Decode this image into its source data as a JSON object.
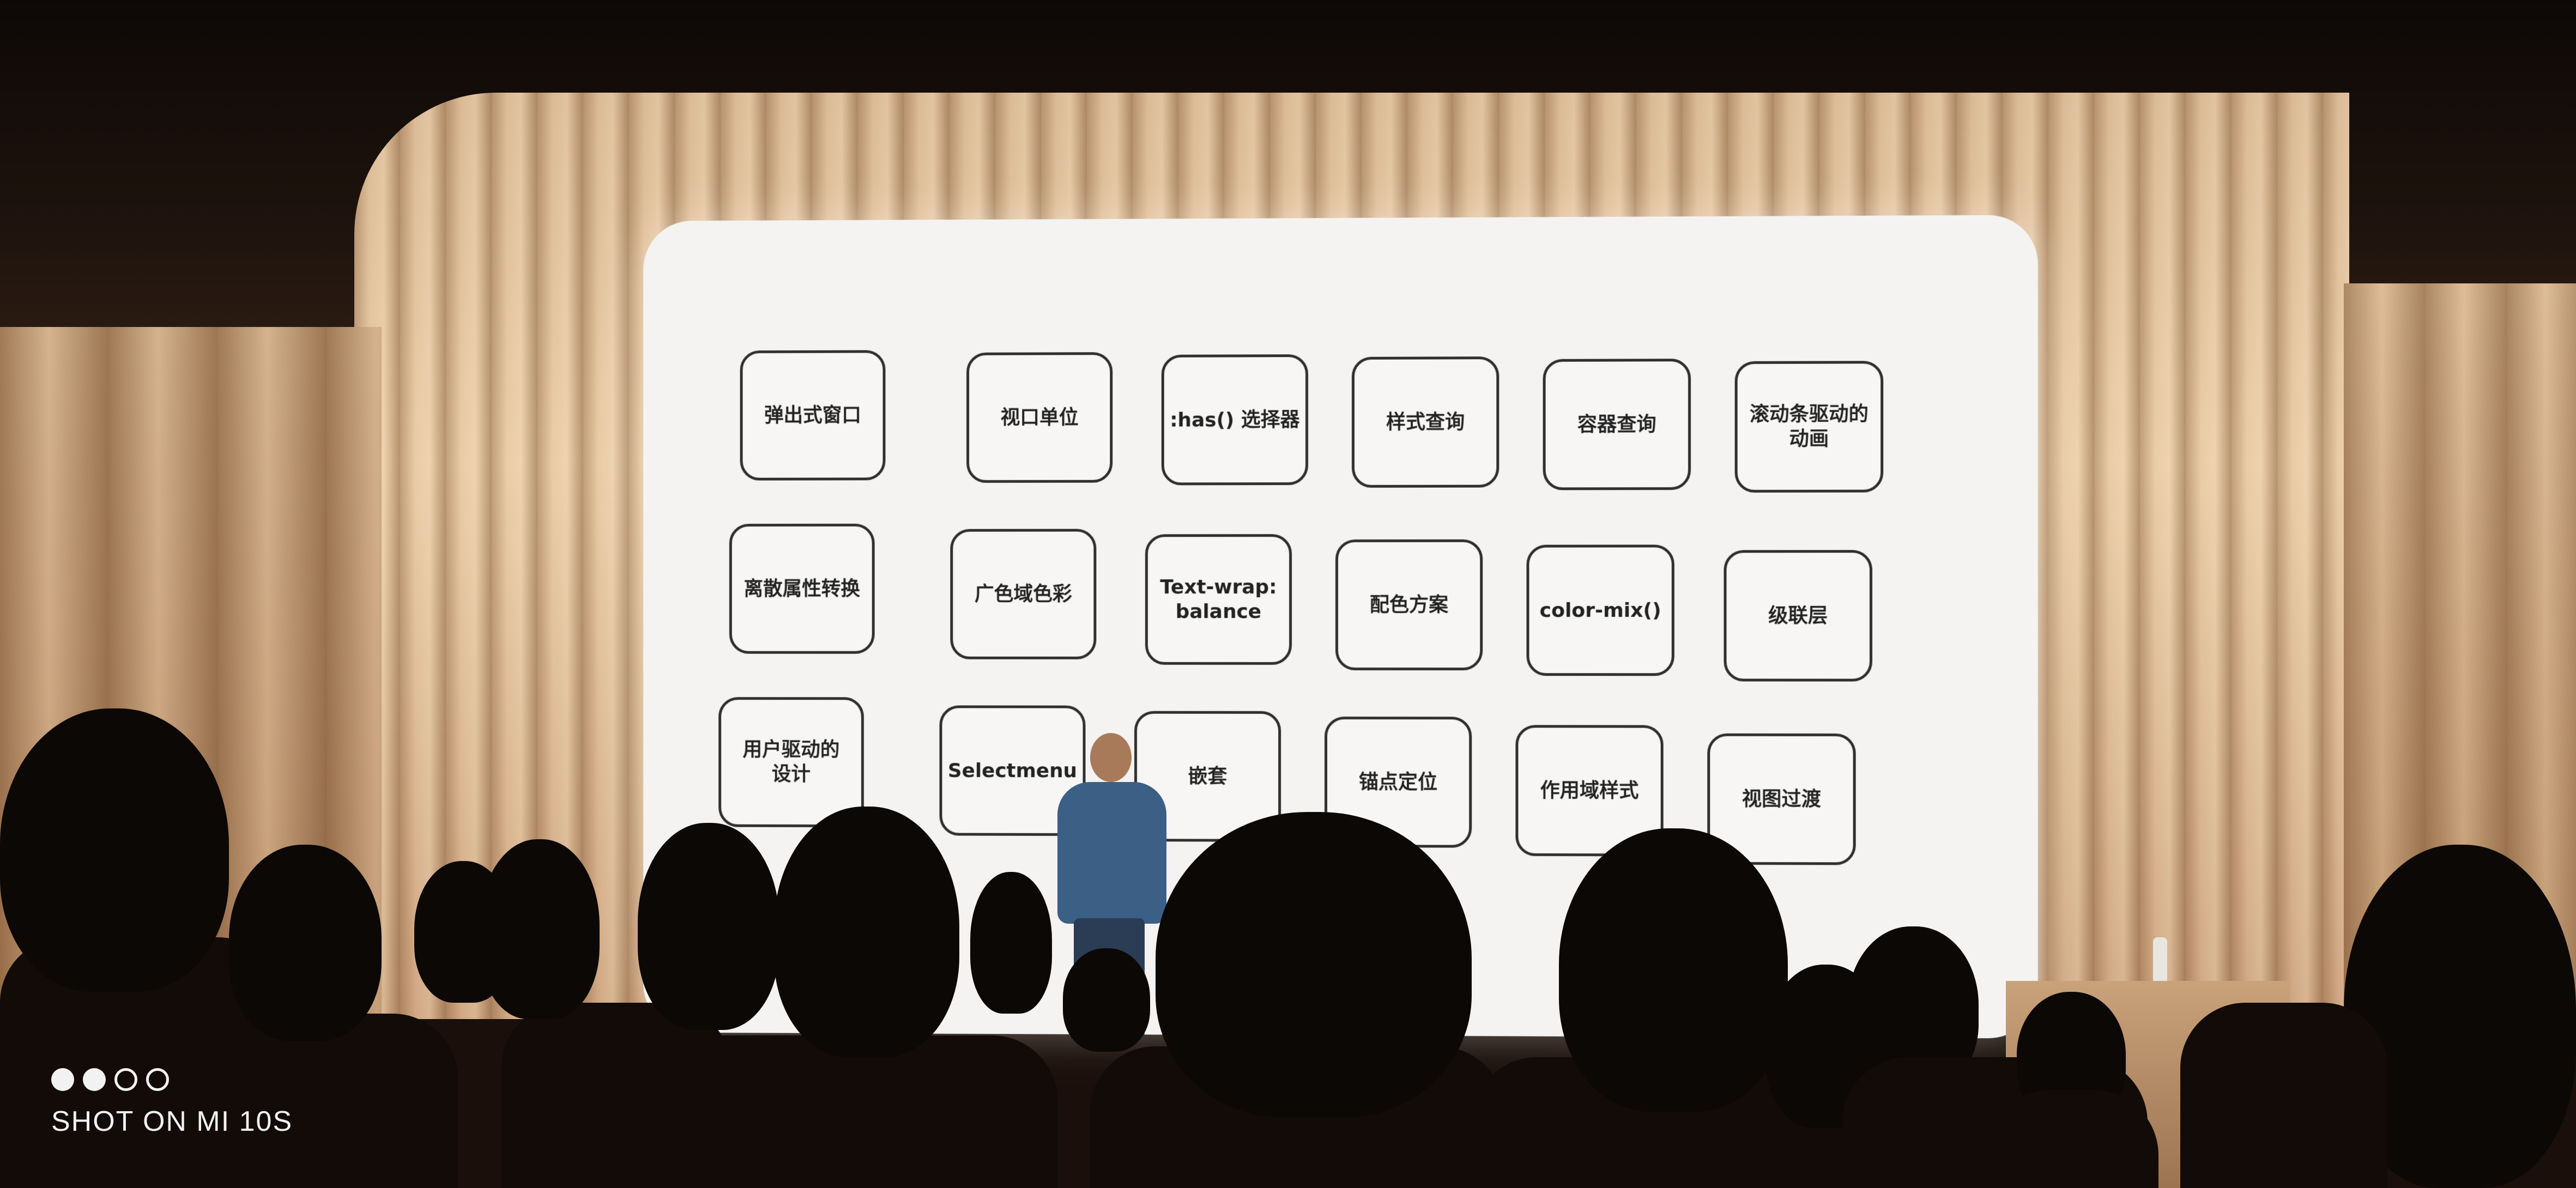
{
  "slide": {
    "tiles": [
      {
        "label": "弹出式窗口"
      },
      {
        "label": "视口单位"
      },
      {
        "label": ":has() 选择器"
      },
      {
        "label": "样式查询"
      },
      {
        "label": "容器查询"
      },
      {
        "label": "滚动条驱动的\n动画"
      },
      {
        "label": "离散属性转换"
      },
      {
        "label": "广色域色彩"
      },
      {
        "label": "Text-wrap:\nbalance"
      },
      {
        "label": "配色方案"
      },
      {
        "label": "color-mix()"
      },
      {
        "label": "级联层"
      },
      {
        "label": "用户驱动的\n设计"
      },
      {
        "label": "Selectmenu"
      },
      {
        "label": "嵌套"
      },
      {
        "label": "锚点定位"
      },
      {
        "label": "作用域样式"
      },
      {
        "label": "视图过渡"
      }
    ]
  },
  "watermark": {
    "text": "SHOT ON MI 10S",
    "dots": [
      "filled",
      "filled",
      "empty",
      "empty"
    ]
  }
}
